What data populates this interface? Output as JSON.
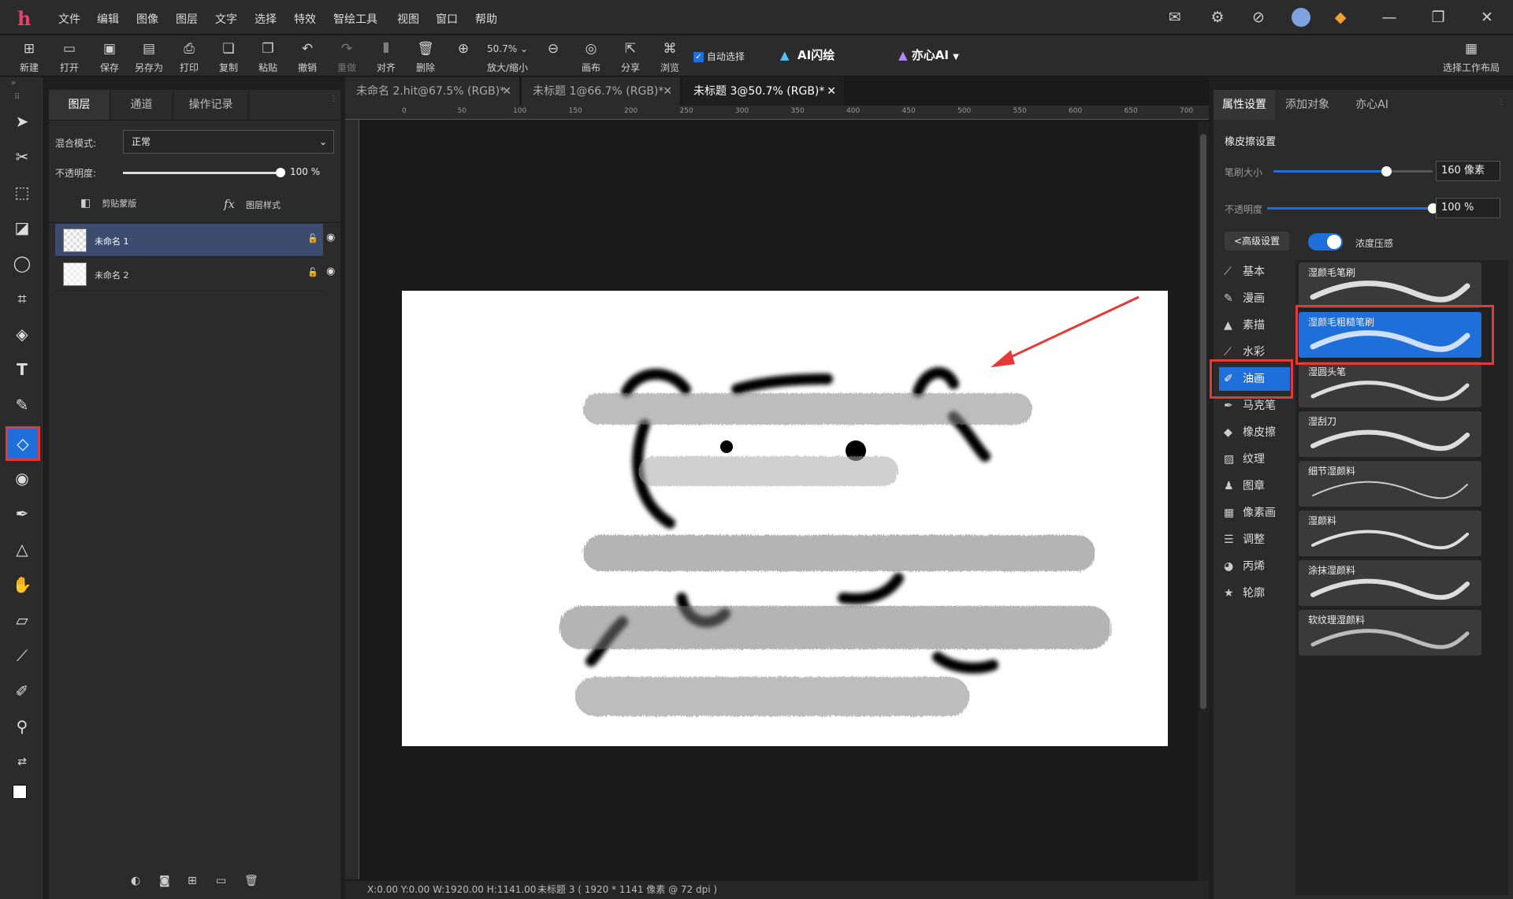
{
  "app": {
    "logo": "h"
  },
  "menu": [
    "文件",
    "编辑",
    "图像",
    "图层",
    "文字",
    "选择",
    "特效",
    "智绘工具",
    "视图",
    "窗口",
    "帮助"
  ],
  "top_icons": [
    "mail-icon",
    "settings-icon",
    "compass-icon",
    "avatar-icon",
    "gem-icon",
    "minimize-icon",
    "restore-icon",
    "close-icon"
  ],
  "toolbar": {
    "new": "新建",
    "open": "打开",
    "save": "保存",
    "save_as": "另存为",
    "print": "打印",
    "copy": "复制",
    "paste": "粘贴",
    "undo": "撤销",
    "redo": "重做",
    "align": "对齐",
    "delete": "删除",
    "zoom_value": "50.7%",
    "zoom_label": "放大/缩小",
    "canvas": "画布",
    "share": "分享",
    "browse": "浏览",
    "auto_select": "自动选择",
    "ai_flash": "AI闪绘",
    "yixin_ai": "亦心AI",
    "layout": "选择工作布局"
  },
  "layers_panel": {
    "tabs": [
      "图层",
      "通道",
      "操作记录"
    ],
    "blend_label": "混合模式:",
    "blend_value": "正常",
    "opacity_label": "不透明度:",
    "opacity_value": "100",
    "opacity_unit": "%",
    "opacity_fraction": 1.0,
    "clip_mask": "剪贴蒙版",
    "layer_style": "图层样式",
    "fx": "fx",
    "layers": [
      {
        "name": "未命名 1",
        "selected": true
      },
      {
        "name": "未命名 2",
        "selected": false
      }
    ]
  },
  "documents": {
    "tabs": [
      {
        "label": "未命名 2.hit@67.5% (RGB)*",
        "active": false
      },
      {
        "label": "未标题 1@66.7% (RGB)*",
        "active": false
      },
      {
        "label": "未标题 3@50.7% (RGB)*",
        "active": true
      }
    ],
    "ruler_ticks": [
      "0",
      "50",
      "100",
      "150",
      "200",
      "250",
      "300",
      "350",
      "400",
      "450",
      "500",
      "550",
      "600",
      "650",
      "700"
    ]
  },
  "status": {
    "coords": "X:0.00 Y:0.00 W:1920.00 H:1141.00",
    "doc_info": "未标题 3 ( 1920 * 1141 像素 @ 72 dpi )"
  },
  "properties": {
    "tabs": [
      "属性设置",
      "添加对象",
      "亦心AI"
    ],
    "section_title": "橡皮擦设置",
    "brush_size_label": "笔刷大小",
    "brush_size_value": "160 像素",
    "brush_size_fraction": 0.71,
    "opacity_label": "不透明度",
    "opacity_value": "100 %",
    "opacity_fraction": 1.0,
    "advanced": "<高级设置",
    "pressure": "浓度压感",
    "pressure_on": true,
    "categories": [
      "基本",
      "漫画",
      "素描",
      "水彩",
      "油画",
      "马克笔",
      "橡皮擦",
      "纹理",
      "图章",
      "像素画",
      "调整",
      "丙烯",
      "轮廓"
    ],
    "selected_category": "油画",
    "brushes": [
      "湿颜毛笔刷",
      "湿颜毛粗糙笔刷",
      "湿圆头笔",
      "湿刮刀",
      "细节湿颜料",
      "湿颜料",
      "涂抹湿颜料",
      "软纹理湿颜料"
    ],
    "selected_brush": "湿颜毛粗糙笔刷"
  },
  "colors": {
    "accent": "#1e6fd9",
    "highlight": "#e53935",
    "panel": "#2b2b2b"
  }
}
